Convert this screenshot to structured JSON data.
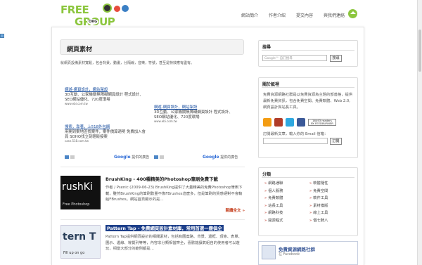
{
  "site": {
    "logo_line1": "FREE",
    "logo_line2": "GROUP",
    "logo_badge": "ORG",
    "brand_color": "#8cc63e"
  },
  "nav": {
    "items": [
      "網站簡介",
      "作者介紹",
      "提交內容",
      "與我們連絡"
    ]
  },
  "main": {
    "title": "網頁素材",
    "intro": "就網頁設備素材寬鬆，包含背景，動畫，分隔線，音樂，符號，甚至是特效應有盡有。",
    "ads_left": [
      {
        "title": "網遊-網頁設計，網站架設",
        "body": "3D互動、公家機關無障礙網頁設計 程式設計、SEO網站優化、720度環場",
        "url": "www.ebi.com.tw"
      },
      {
        "title": "搜索，靠著，上518外包網",
        "body": "用開到案地區找案件，案件價算適明 免費加入會員 SOHO找立刻輕鬆接案",
        "url": "case.518.com.tw"
      }
    ],
    "ads_right": [
      {
        "title": "網遊-網頁設計，網站架設",
        "body": "3D互動、公家機關無障礙網頁設計 程式設計、SEO網站優化、720度環場",
        "url": "www.ebi.com.tw"
      }
    ],
    "google_label": "提供的廣告",
    "google_word": "Google",
    "posts": [
      {
        "title": "BrushKing - 400種精美的Photoshop筆刷免費下載",
        "meta": "作者 / Psenic (2009-06-23)",
        "text": "BrushKing提供了大量精美的免費Photoshop筆刷下載，雖然BrushKing的筆刷數量不像FBrushes這麼多，但是筆刷的質感絕對不會輸給FBrushes。網站首頁顯示的是…",
        "more": "閱讀全文 »",
        "thumb_big": "rushKi",
        "thumb_sub": "Free Photoshop"
      },
      {
        "title": "Pattern Tap - 免費網頁設計素材庫，常用首選一應俱全",
        "text": "Pattern Tap提供網頁設計的相關素材，包括有圖案路、背景、邊框、頂條、表單、圖示、邊線、導覽列等等，內容非分類相當齊全，喜歡能讓氣組自的使用者可以遊玩，相當大部分的範例都是…",
        "more": "閱讀全文 »",
        "thumb_big": "tern T",
        "thumb_sub": "Fill up on go"
      }
    ]
  },
  "sidebar": {
    "search": {
      "header": "搜尋",
      "placeholder": "Google™ 自訂搜尋",
      "button": "搜尋"
    },
    "about": {
      "header": "關於艇裡",
      "text": "免費資源網路社群是以免費資源為主題的部落格，提供最新免費資訊，包含免費空間、免費軟體、Web 2.0, 網頁設計與站長工具。",
      "readers": "16493 readers",
      "readers_by": "BY FEEDBURNER",
      "subscribe_label": "訂閱最新文章，輸入你的 Email 信箱：",
      "subscribe_button": "訂閱"
    },
    "categories": {
      "header": "分類",
      "items": [
        "網路通聯",
        "軟體隨性",
        "個人服務",
        "免費空間",
        "免費軟體",
        "軟件工具",
        "站長工具",
        "素材模版",
        "網路科技",
        "線上工具",
        "開源程式",
        "個七騎八"
      ]
    },
    "facebook": {
      "title": "免費資源網路社群",
      "subtitle": "在 Facebook"
    }
  }
}
